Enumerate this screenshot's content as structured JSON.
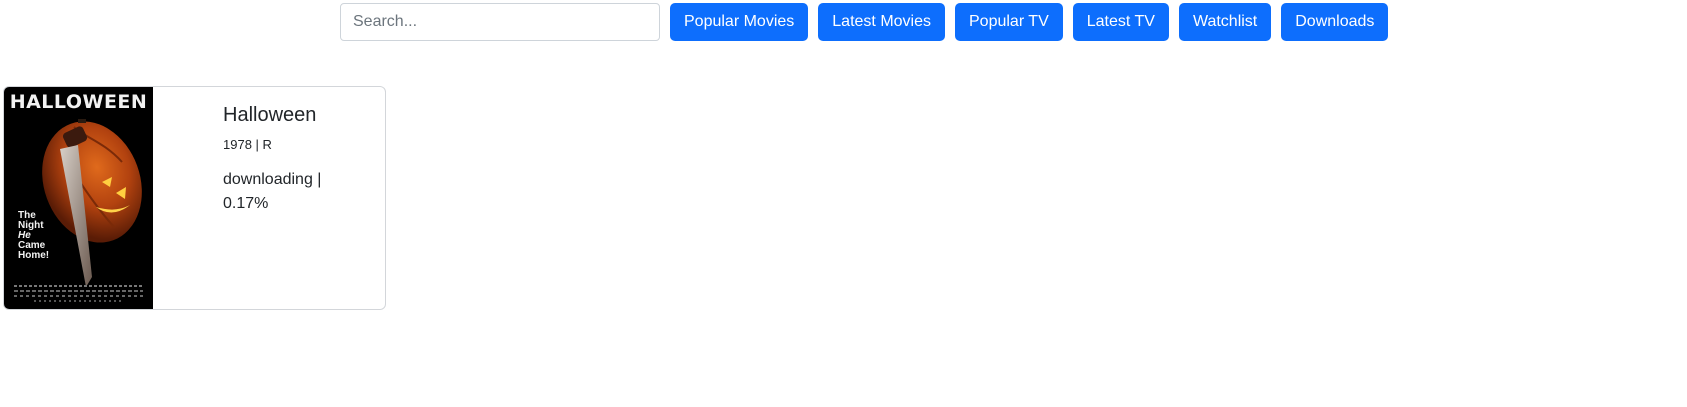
{
  "search": {
    "placeholder": "Search...",
    "value": ""
  },
  "nav": {
    "popular_movies": "Popular Movies",
    "latest_movies": "Latest Movies",
    "popular_tv": "Popular TV",
    "latest_tv": "Latest TV",
    "watchlist": "Watchlist",
    "downloads": "Downloads"
  },
  "colors": {
    "primary": "#0d6efd"
  },
  "downloads": [
    {
      "title": "Halloween",
      "year_rating": "1978 | R",
      "status": "downloading |",
      "progress": "0.17%",
      "poster": {
        "title": "HALLOWEEN",
        "tagline_1": "The",
        "tagline_2": "Night",
        "tagline_3": "He",
        "tagline_4": "Came",
        "tagline_5": "Home!"
      }
    }
  ]
}
